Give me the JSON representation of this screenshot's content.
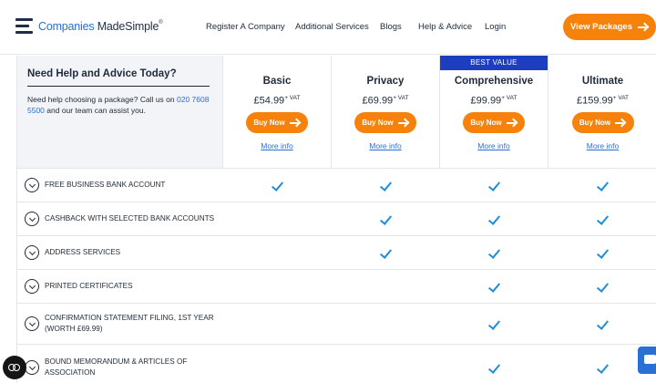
{
  "header": {
    "logo_part1": "Companies",
    "logo_part2": "MadeSimple",
    "logo_tm": "®",
    "nav": [
      {
        "label": "Register A Company"
      },
      {
        "label": "Additional Services"
      },
      {
        "label": "Blogs"
      },
      {
        "label": "Help & Advice"
      },
      {
        "label": "Login"
      }
    ],
    "cta_label": "View Packages"
  },
  "help": {
    "title": "Need Help and Advice Today?",
    "text_before": "Need help choosing a package? Call us on ",
    "phone": "020 7608 5500",
    "text_after": " and our team can assist you."
  },
  "packages": [
    {
      "name": "Basic",
      "price": "£54.99",
      "vat": "+ VAT",
      "badge": "",
      "buy_label": "Buy Now",
      "more_label": "More info"
    },
    {
      "name": "Privacy",
      "price": "£69.99",
      "vat": "+ VAT",
      "badge": "",
      "buy_label": "Buy Now",
      "more_label": "More info"
    },
    {
      "name": "Comprehensive",
      "price": "£99.99",
      "vat": "+ VAT",
      "badge": "BEST VALUE",
      "buy_label": "Buy Now",
      "more_label": "More info"
    },
    {
      "name": "Ultimate",
      "price": "£159.99",
      "vat": "+ VAT",
      "badge": "",
      "buy_label": "Buy Now",
      "more_label": "More info"
    }
  ],
  "features": [
    {
      "label": "FREE BUSINESS BANK ACCOUNT",
      "included": [
        true,
        true,
        true,
        true
      ]
    },
    {
      "label": "CASHBACK WITH SELECTED BANK ACCOUNTS",
      "included": [
        false,
        true,
        true,
        true
      ]
    },
    {
      "label": "ADDRESS SERVICES",
      "included": [
        false,
        true,
        true,
        true
      ]
    },
    {
      "label": "PRINTED CERTIFICATES",
      "included": [
        false,
        false,
        true,
        true
      ]
    },
    {
      "label": "CONFIRMATION STATEMENT FILING, 1ST YEAR (WORTH £69.99)",
      "included": [
        false,
        false,
        true,
        true
      ]
    },
    {
      "label": "BOUND MEMORANDUM & ARTICLES OF ASSOCIATION",
      "included": [
        false,
        false,
        true,
        true
      ]
    }
  ],
  "icons": {
    "menu": "hamburger-menu-icon",
    "expand": "chevron-down-circle-icon",
    "check": "checkmark-icon",
    "cookie": "cookie-settings-icon",
    "chat": "chat-icon"
  },
  "colors": {
    "accent": "#f6820c",
    "link": "#2a6fd6",
    "badge": "#1d3fbf",
    "check": "#1e8ed8"
  }
}
